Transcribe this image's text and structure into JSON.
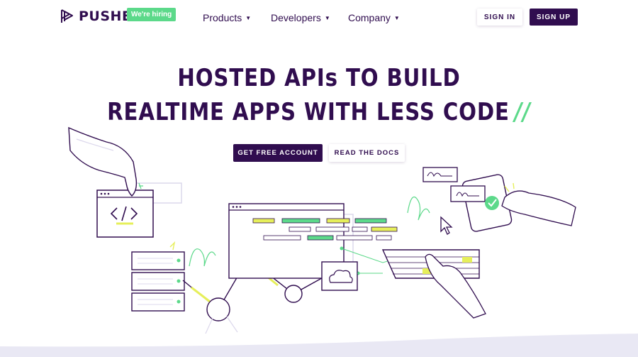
{
  "brand": {
    "name": "PUSHER",
    "hiring_badge": "We're hiring"
  },
  "nav": {
    "items": [
      {
        "label": "Products"
      },
      {
        "label": "Developers"
      },
      {
        "label": "Company"
      }
    ],
    "sign_in": "SIGN IN",
    "sign_up": "SIGN UP"
  },
  "hero": {
    "line1": "HOSTED APIs TO BUILD",
    "line2": "REALTIME APPS WITH LESS CODE",
    "slashes": "//",
    "cta_primary": "GET FREE ACCOUNT",
    "cta_secondary": "READ THE DOCS"
  },
  "colors": {
    "brand_purple": "#300d4f",
    "accent_green": "#5cd98a",
    "accent_yellow": "#e6ef5a",
    "lavender": "#dcd8ec"
  }
}
